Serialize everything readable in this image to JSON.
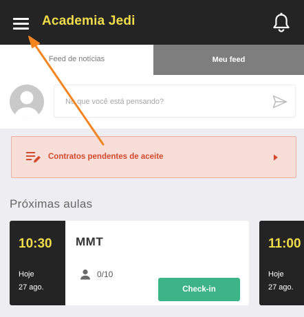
{
  "header": {
    "title": "Academia Jedi",
    "menu_icon": "hamburger-menu-icon",
    "notification_icon": "bell-icon",
    "background": "#242424",
    "title_color": "#f0dc4a"
  },
  "tabs": [
    {
      "label": "Feed de notícias",
      "active": true
    },
    {
      "label": "Meu feed",
      "active": false
    }
  ],
  "composer": {
    "placeholder": "No que você está pensando?",
    "avatar_icon": "user-avatar-placeholder",
    "send_icon": "send-icon"
  },
  "alert": {
    "label": "Contratos pendentes de aceite",
    "icon": "edit-list-icon",
    "color": "#d4492e",
    "background": "#f7ded7"
  },
  "upcoming": {
    "title": "Próximas aulas",
    "classes": [
      {
        "time": "10:30",
        "day": "Hoje",
        "date": "27 ago.",
        "name": "MMT",
        "capacity": "0/10",
        "action": "Check-in"
      },
      {
        "time": "11:00",
        "day": "Hoje",
        "date": "27 ago."
      }
    ]
  },
  "colors": {
    "accent_yellow": "#f0dc4a",
    "checkin_green": "#3db487",
    "annotation_orange": "#f5841f"
  }
}
